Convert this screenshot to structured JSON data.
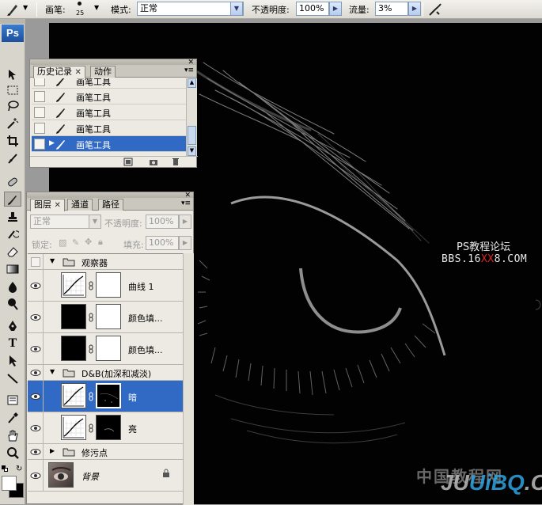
{
  "options_bar": {
    "brush_label": "画笔:",
    "brush_size": "25",
    "mode_label": "模式:",
    "mode_value": "正常",
    "opacity_label": "不透明度:",
    "opacity_value": "100%",
    "flow_label": "流量:",
    "flow_value": "3%"
  },
  "toolbox": {
    "logo": "Ps"
  },
  "history_panel": {
    "tabs": [
      "历史记录",
      "动作"
    ],
    "items": [
      {
        "label": "画笔工具",
        "selected": false
      },
      {
        "label": "画笔工具",
        "selected": false
      },
      {
        "label": "画笔工具",
        "selected": false
      },
      {
        "label": "画笔工具",
        "selected": false
      },
      {
        "label": "画笔工具",
        "selected": true
      }
    ]
  },
  "layers_panel": {
    "tabs": [
      "图层",
      "通道",
      "路径"
    ],
    "blend_mode": "正常",
    "opacity_label": "不透明度:",
    "opacity_value": "100%",
    "lock_label": "锁定:",
    "fill_label": "填充:",
    "fill_value": "100%",
    "layers": [
      {
        "type": "group",
        "name": "观察器",
        "visible": false,
        "expanded": true
      },
      {
        "type": "adjustment",
        "name": "曲线 1",
        "visible": true
      },
      {
        "type": "fill",
        "name": "颜色填...",
        "visible": true
      },
      {
        "type": "fill",
        "name": "颜色填...",
        "visible": true
      },
      {
        "type": "group",
        "name": "D&B(加深和减淡)",
        "visible": true,
        "expanded": true
      },
      {
        "type": "adjustment",
        "name": "暗",
        "visible": true,
        "selected": true
      },
      {
        "type": "adjustment",
        "name": "亮",
        "visible": true
      },
      {
        "type": "group",
        "name": "修污点",
        "visible": true,
        "expanded": false
      },
      {
        "type": "image",
        "name": "背景",
        "visible": true,
        "locked": true
      }
    ]
  },
  "watermarks": {
    "forum_name": "PS教程论坛",
    "forum_url_prefix": "BBS.16",
    "forum_url_red": "XX",
    "forum_url_suffix": "8.COM",
    "site_cn": "中国教程网",
    "site_prefix": "JU",
    "site_accent": "UiBQ",
    "site_suffix": ".COM"
  },
  "colors": {
    "selection": "#316ac5",
    "canvas": "#020202",
    "panel": "#eceae2"
  }
}
